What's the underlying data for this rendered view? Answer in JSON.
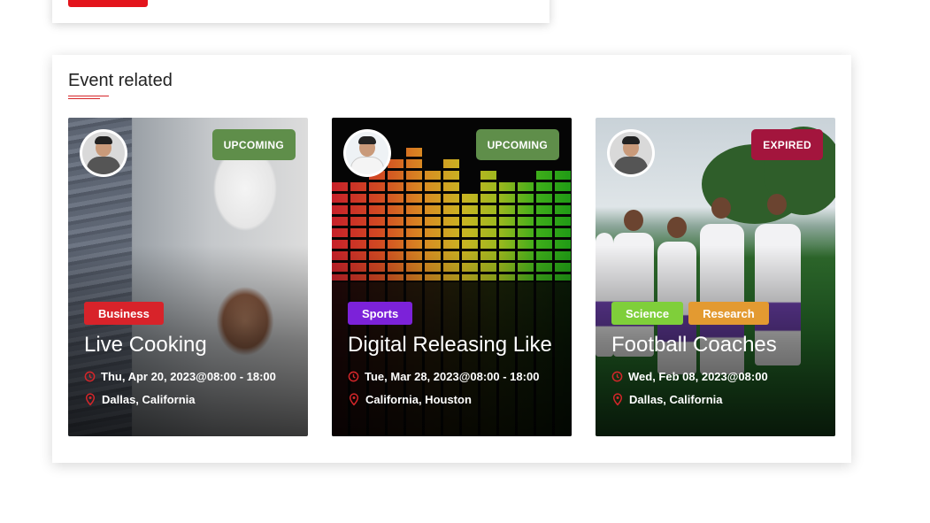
{
  "section": {
    "title": "Event related"
  },
  "colors": {
    "accent": "#d6262a",
    "upcoming": "#5f8e4a",
    "expired": "#a3153d",
    "business": "#d8232a",
    "sports": "#7c22d9",
    "science": "#7fcf3a",
    "research": "#e39a31"
  },
  "events": [
    {
      "status": "UPCOMING",
      "tags": [
        "Business"
      ],
      "title": "Live Cooking",
      "date": "Thu, Apr 20, 2023@08:00 - 18:00",
      "location": "Dallas, California",
      "image": "chef-cooking-photo"
    },
    {
      "status": "UPCOMING",
      "tags": [
        "Sports"
      ],
      "title": "Digital Releasing Like",
      "date": "Tue, Mar 28, 2023@08:00 - 18:00",
      "location": "California, Houston",
      "image": "music-equalizer-photo"
    },
    {
      "status": "EXPIRED",
      "tags": [
        "Science",
        "Research"
      ],
      "title": "Football Coaches",
      "date": "Wed, Feb 08, 2023@08:00",
      "location": "Dallas, California",
      "image": "kids-football-photo"
    }
  ],
  "icons": {
    "date": "clock-icon",
    "location": "map-pin-icon"
  }
}
